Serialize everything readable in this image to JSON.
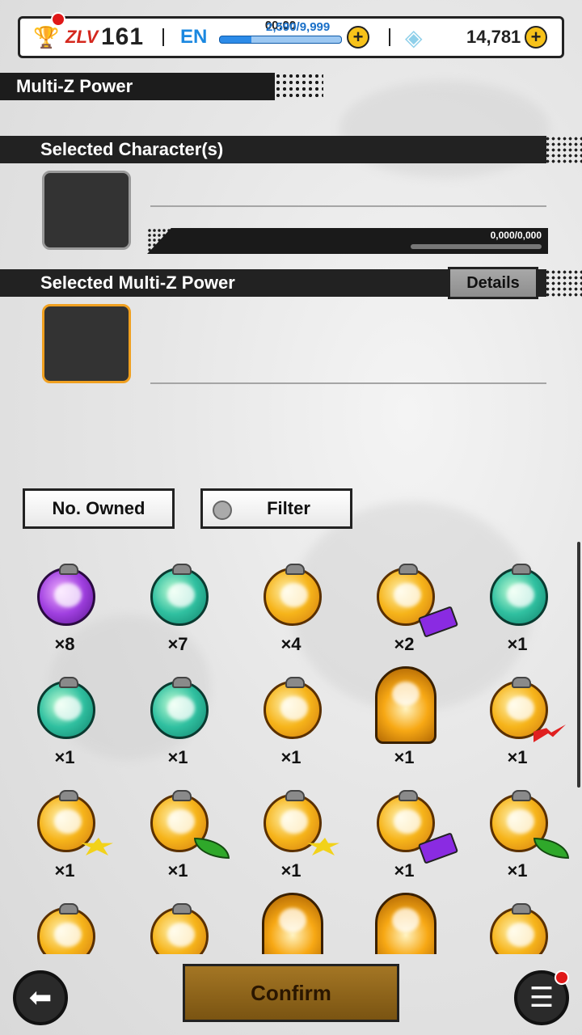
{
  "status_bar": {
    "zlv_label": "ZLV",
    "level": "161",
    "energy_label": "EN",
    "energy_timer": "00:00",
    "energy_value": "2,590/9,999",
    "energy_fill": 0.26,
    "chrono_crystals": "14,781"
  },
  "page_title": "Multi-Z Power",
  "selected_characters": {
    "label": "Selected Character(s)",
    "progress_text": "0,000/0,000"
  },
  "selected_power": {
    "label": "Selected Multi-Z Power",
    "details_label": "Details"
  },
  "sort_button": {
    "label": "No. Owned"
  },
  "filter_button": {
    "label": "Filter"
  },
  "items": [
    {
      "kind": "purple",
      "count": "×8",
      "badge": ""
    },
    {
      "kind": "green",
      "count": "×7",
      "badge": ""
    },
    {
      "kind": "orange",
      "count": "×4",
      "badge": ""
    },
    {
      "kind": "orange",
      "count": "×2",
      "badge": "purple"
    },
    {
      "kind": "green",
      "count": "×1",
      "badge": ""
    },
    {
      "kind": "green",
      "count": "×1",
      "badge": ""
    },
    {
      "kind": "green",
      "count": "×1",
      "badge": ""
    },
    {
      "kind": "orange",
      "count": "×1",
      "badge": ""
    },
    {
      "kind": "jar",
      "count": "×1",
      "badge": ""
    },
    {
      "kind": "orange",
      "count": "×1",
      "badge": "red"
    },
    {
      "kind": "orange",
      "count": "×1",
      "badge": "star"
    },
    {
      "kind": "orange",
      "count": "×1",
      "badge": "leaf"
    },
    {
      "kind": "orange",
      "count": "×1",
      "badge": "star"
    },
    {
      "kind": "orange",
      "count": "×1",
      "badge": "purple"
    },
    {
      "kind": "orange",
      "count": "×1",
      "badge": "leaf"
    },
    {
      "kind": "orange",
      "count": "",
      "badge": ""
    },
    {
      "kind": "orange",
      "count": "",
      "badge": ""
    },
    {
      "kind": "jar",
      "count": "",
      "badge": ""
    },
    {
      "kind": "jar",
      "count": "",
      "badge": ""
    },
    {
      "kind": "orange",
      "count": "",
      "badge": ""
    }
  ],
  "confirm_label": "Confirm",
  "icons": {
    "back": "back-arrow-icon",
    "menu": "hamburger-menu-icon"
  },
  "colors": {
    "accent": "#f0a020",
    "header": "#222222",
    "confirm": "#8b6118"
  }
}
